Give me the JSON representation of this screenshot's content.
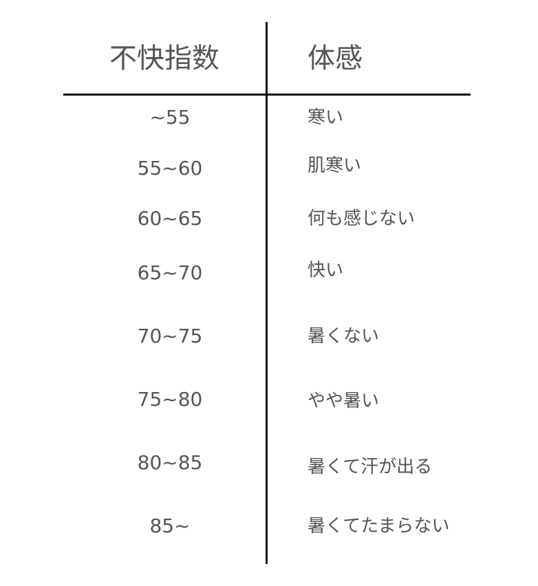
{
  "table": {
    "headers": {
      "index": "不快指数",
      "feeling": "体感"
    },
    "rows": [
      {
        "index": "~55",
        "feeling": "寒い"
      },
      {
        "index": "55~60",
        "feeling": "肌寒い"
      },
      {
        "index": "60~65",
        "feeling": "何も感じない"
      },
      {
        "index": "65~70",
        "feeling": "快い"
      },
      {
        "index": "70~75",
        "feeling": "暑くない"
      },
      {
        "index": "75~80",
        "feeling": "やや暑い"
      },
      {
        "index": "80~85",
        "feeling": "暑くて汗が出る"
      },
      {
        "index": "85~",
        "feeling": "暑くてたまらない"
      }
    ]
  }
}
